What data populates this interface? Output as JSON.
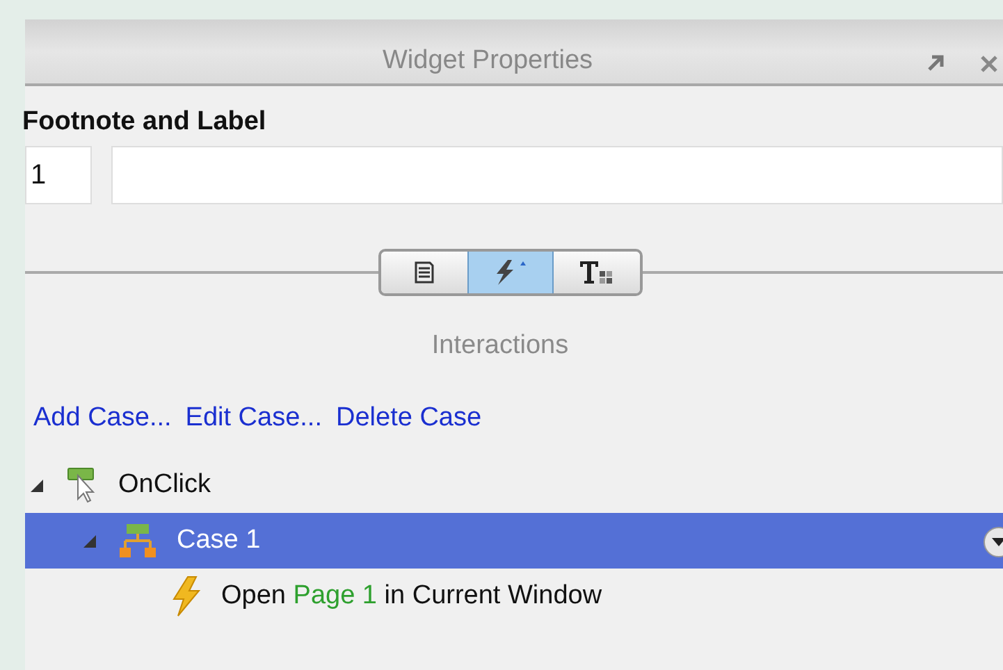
{
  "panel": {
    "title": "Widget Properties"
  },
  "footnote": {
    "heading": "Footnote and Label",
    "number": "1"
  },
  "view_buttons": [
    {
      "kind": "notes",
      "selected": false
    },
    {
      "kind": "interactions",
      "selected": true
    },
    {
      "kind": "style",
      "selected": false
    }
  ],
  "section_title": "Interactions",
  "links": [
    "Add Case...",
    "Edit Case...",
    "Delete Case"
  ],
  "tree": [
    {
      "kind": "event",
      "label": "OnClick",
      "expanded": true,
      "selected": false,
      "children": [
        {
          "kind": "case",
          "label": "Case 1",
          "expanded": true,
          "selected": true,
          "children": [
            {
              "kind": "action",
              "selected": false,
              "segments": [
                {
                  "kind": "plain",
                  "text": "Open "
                },
                {
                  "kind": "target",
                  "text": "Page 1"
                },
                {
                  "kind": "plain",
                  "text": " in Current Window"
                }
              ]
            }
          ]
        }
      ]
    }
  ]
}
